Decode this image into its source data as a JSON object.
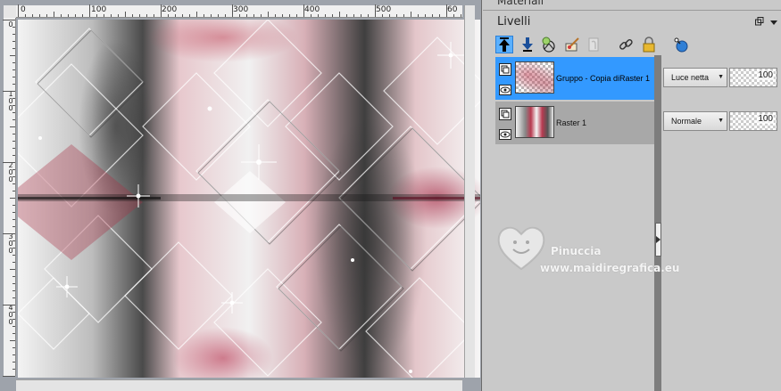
{
  "rulers": {
    "top_labels": [
      "0",
      "100",
      "200",
      "300",
      "400",
      "500",
      "60"
    ],
    "left_labels": [
      "0",
      "1 0 0",
      "2 0 0",
      "3 0 0",
      "4 0 0"
    ]
  },
  "panels": {
    "materiali_title": "Materiali",
    "livelli_title": "Livelli",
    "header_buttons": [
      "restore-icon",
      "dropdown-arrow-icon"
    ]
  },
  "toolbar": {
    "icons": [
      "move-up-icon",
      "move-down-icon",
      "new-layer-icon",
      "edit-brush-icon",
      "mask-icon",
      "link-icon",
      "lock-icon",
      "merge-icon"
    ],
    "active_index": 0
  },
  "layers": [
    {
      "name": "Gruppo - Copia diRaster 1",
      "blend_mode": "Luce netta",
      "opacity": "100",
      "selected": true
    },
    {
      "name": "Raster 1",
      "blend_mode": "Normale",
      "opacity": "100",
      "selected": false
    }
  ],
  "watermark": {
    "name": "Pinuccia",
    "url": "www.maidiregrafica.eu"
  },
  "colors": {
    "selection": "#3399ff",
    "panel_bg": "#c9c9c9",
    "accent_red": "#b83a50"
  }
}
